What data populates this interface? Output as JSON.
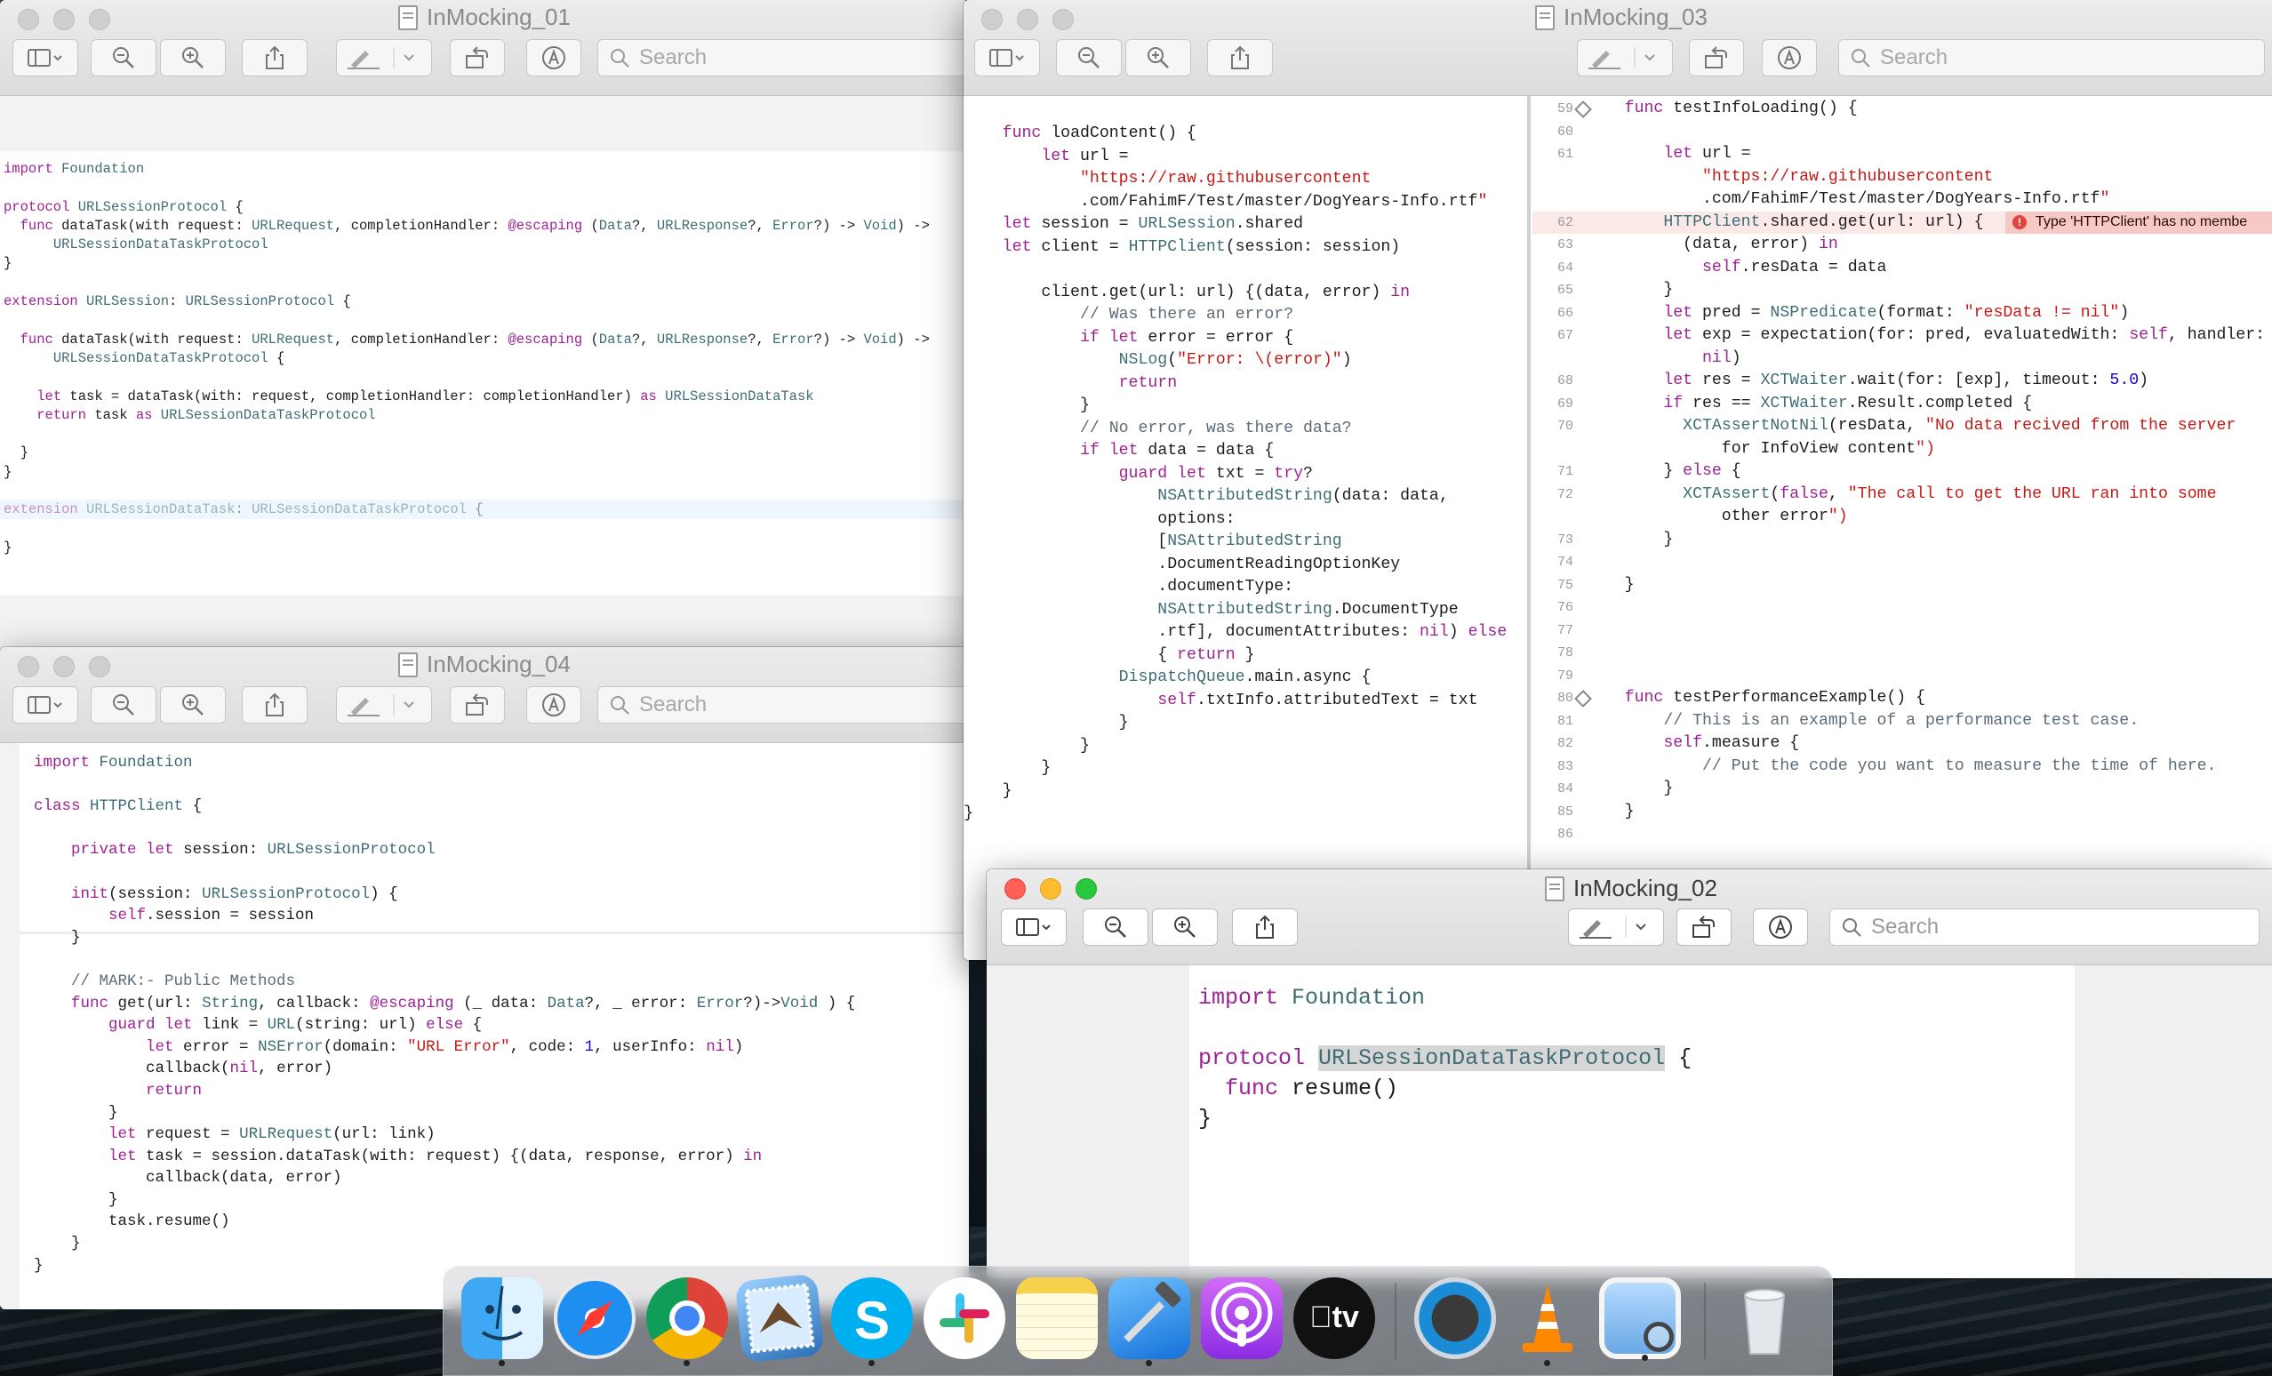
{
  "windows": {
    "w01": {
      "title": "InMocking_01",
      "search_placeholder": "Search",
      "lines": [
        [
          "import",
          "Foundation"
        ],
        [],
        [
          "protocol",
          "URLSessionProtocol {"
        ],
        [
          "  func dataTask(with request: URLRequest, completionHandler: @escaping (Data?, URLResponse?, Error?) -> Void) ->"
        ],
        [
          "      URLSessionDataTaskProtocol"
        ],
        [
          "}"
        ],
        [],
        [
          "extension URLSession: URLSessionProtocol {"
        ],
        [],
        [
          "  func dataTask(with request: URLRequest, completionHandler: @escaping (Data?, URLResponse?, Error?) -> Void) ->"
        ],
        [
          "      URLSessionDataTaskProtocol {"
        ],
        [],
        [
          "    let task = dataTask(with: request, completionHandler: completionHandler) as URLSessionDataTask"
        ],
        [
          "    return task as URLSessionDataTaskProtocol"
        ],
        [],
        [
          "  }"
        ],
        [
          "}"
        ],
        [],
        [
          "extension URLSessionDataTask: URLSessionDataTaskProtocol {"
        ],
        [],
        [
          "}"
        ]
      ]
    },
    "w03": {
      "title": "InMocking_03",
      "search_placeholder": "Search",
      "left_code": [
        "    func loadContent() {",
        "        let url =",
        "            \"https://raw.githubusercontent",
        "            .com/FahimF/Test/master/DogYears-Info.rtf\"",
        "    let session = URLSession.shared",
        "    let client = HTTPClient(session: session)",
        "",
        "        client.get(url: url) {(data, error) in",
        "            // Was there an error?",
        "            if let error = error {",
        "                NSLog(\"Error: \\(error)\")",
        "                return",
        "            }",
        "            // No error, was there data?",
        "            if let data = data {",
        "                guard let txt = try?",
        "                    NSAttributedString(data: data,",
        "                    options:",
        "                    [NSAttributedString",
        "                    .DocumentReadingOptionKey",
        "                    .documentType:",
        "                    NSAttributedString.DocumentType",
        "                    .rtf], documentAttributes: nil) else",
        "                    { return }",
        "                DispatchQueue.main.async {",
        "                    self.txtInfo.attributedText = txt",
        "                }",
        "            }",
        "        }",
        "    }",
        "}"
      ],
      "right_lines": [
        {
          "n": "59",
          "code": "    func testInfoLoading() {"
        },
        {
          "n": "60",
          "code": ""
        },
        {
          "n": "61",
          "code": "        let url ="
        },
        {
          "n": "",
          "code": "            \"https://raw.githubusercontent"
        },
        {
          "n": "",
          "code": "            .com/FahimF/Test/master/DogYears-Info.rtf\""
        },
        {
          "n": "62",
          "code": "        HTTPClient.shared.get(url: url) {"
        },
        {
          "n": "63",
          "code": "          (data, error) in"
        },
        {
          "n": "64",
          "code": "            self.resData = data"
        },
        {
          "n": "65",
          "code": "        }"
        },
        {
          "n": "66",
          "code": "        let pred = NSPredicate(format: \"resData != nil\")"
        },
        {
          "n": "67",
          "code": "        let exp = expectation(for: pred, evaluatedWith: self, handler:"
        },
        {
          "n": "",
          "code": "            nil)"
        },
        {
          "n": "68",
          "code": "        let res = XCTWaiter.wait(for: [exp], timeout: 5.0)"
        },
        {
          "n": "69",
          "code": "        if res == XCTWaiter.Result.completed {"
        },
        {
          "n": "70",
          "code": "          XCTAssertNotNil(resData, \"No data recived from the server"
        },
        {
          "n": "",
          "code": "              for InfoView content\")"
        },
        {
          "n": "71",
          "code": "        } else {"
        },
        {
          "n": "72",
          "code": "          XCTAssert(false, \"The call to get the URL ran into some"
        },
        {
          "n": "",
          "code": "              other error\")"
        },
        {
          "n": "73",
          "code": "        }"
        },
        {
          "n": "74",
          "code": ""
        },
        {
          "n": "75",
          "code": "    }"
        },
        {
          "n": "76",
          "code": ""
        },
        {
          "n": "77",
          "code": ""
        },
        {
          "n": "78",
          "code": ""
        },
        {
          "n": "79",
          "code": ""
        },
        {
          "n": "80",
          "code": "    func testPerformanceExample() {"
        },
        {
          "n": "81",
          "code": "        // This is an example of a performance test case."
        },
        {
          "n": "82",
          "code": "        self.measure {"
        },
        {
          "n": "83",
          "code": "            // Put the code you want to measure the time of here."
        },
        {
          "n": "84",
          "code": "        }"
        },
        {
          "n": "85",
          "code": "    }"
        },
        {
          "n": "86",
          "code": ""
        }
      ],
      "error_text": "Type 'HTTPClient' has no membe"
    },
    "w04": {
      "title": "InMocking_04",
      "search_placeholder": "Search",
      "code": [
        "import Foundation",
        "",
        "class HTTPClient {",
        "",
        "    private let session: URLSessionProtocol",
        "",
        "    init(session: URLSessionProtocol) {",
        "        self.session = session",
        "    }",
        "",
        "    // MARK:- Public Methods",
        "    func get(url: String, callback: @escaping (_ data: Data?, _ error: Error?)->Void ) {",
        "        guard let link = URL(string: url) else {",
        "            let error = NSError(domain: \"URL Error\", code: 1, userInfo: nil)",
        "            callback(nil, error)",
        "            return",
        "        }",
        "        let request = URLRequest(url: link)",
        "        let task = session.dataTask(with: request) {(data, response, error) in",
        "            callback(data, error)",
        "        }",
        "        task.resume()",
        "    }",
        "}"
      ]
    },
    "w02": {
      "title": "InMocking_02",
      "search_placeholder": "Search",
      "code": [
        "import Foundation",
        "",
        "protocol URLSessionDataTaskProtocol {",
        "  func resume()",
        "}"
      ]
    }
  },
  "dock": {
    "apps": [
      {
        "name": "Finder",
        "icon": "finder-icon",
        "running": true
      },
      {
        "name": "Safari",
        "icon": "safari-icon",
        "running": false
      },
      {
        "name": "Chrome",
        "icon": "chrome-icon",
        "running": true
      },
      {
        "name": "Mail",
        "icon": "mail-icon",
        "running": false
      },
      {
        "name": "Skype",
        "icon": "skype-icon",
        "running": true
      },
      {
        "name": "Slack",
        "icon": "slack-icon",
        "running": false
      },
      {
        "name": "Notes",
        "icon": "notes-icon",
        "running": false
      },
      {
        "name": "Xcode",
        "icon": "xcode-icon",
        "running": true
      },
      {
        "name": "Podcasts",
        "icon": "podcasts-icon",
        "running": false
      },
      {
        "name": "TV",
        "icon": "tv-icon",
        "running": false
      },
      {
        "name": "QuickTime",
        "icon": "quicktime-icon",
        "running": false
      },
      {
        "name": "VLC",
        "icon": "vlc-icon",
        "running": true
      },
      {
        "name": "Preview",
        "icon": "preview-icon",
        "running": true
      },
      {
        "name": "Trash",
        "icon": "trash-icon",
        "running": false
      }
    ],
    "tv_label": "tv"
  },
  "colors": {
    "keyword": "#9b2393",
    "type": "#3e6d74",
    "string": "#c41a16",
    "comment": "#5d6c79",
    "error": "#e0443e"
  }
}
